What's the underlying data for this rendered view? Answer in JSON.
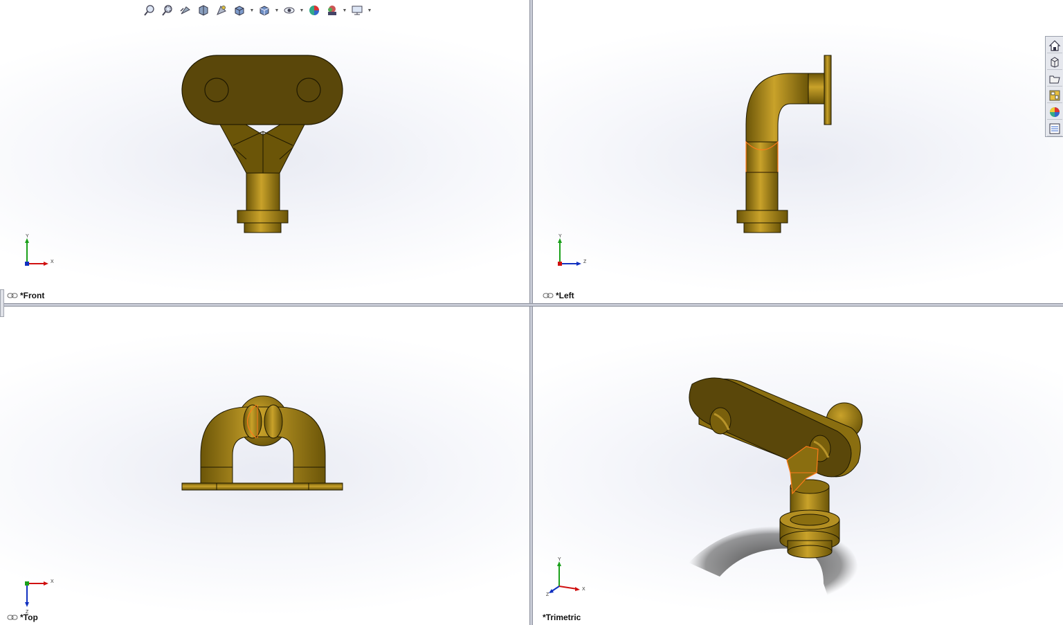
{
  "viewports": {
    "front": {
      "label": "*Front",
      "axis_up": "Y",
      "axis_right": "X"
    },
    "left": {
      "label": "*Left",
      "axis_up": "Y",
      "axis_right": "Z"
    },
    "top": {
      "label": "*Top",
      "axis_up": "Z",
      "axis_right": "X"
    },
    "trimetric": {
      "label": "*Trimetric",
      "axis_up": "Y",
      "axis_right": "X",
      "axis_depth": "Z"
    }
  },
  "toolbar": {
    "icons": [
      "zoom-to-fit-icon",
      "zoom-to-area-icon",
      "previous-view-icon",
      "section-view-icon",
      "dynamic-annotation-icon",
      "view-orientation-icon",
      "display-style-icon",
      "hide-show-items-icon",
      "edit-appearance-icon",
      "apply-scene-icon",
      "view-settings-icon"
    ]
  },
  "task_pane": {
    "icons": [
      "home-icon",
      "design-library-icon",
      "file-explorer-icon",
      "view-palette-icon",
      "appearances-icon",
      "custom-properties-icon"
    ]
  },
  "colors": {
    "part_body": "#8a6e10",
    "part_dark": "#5a470a",
    "selection": "#ff7a1a"
  }
}
